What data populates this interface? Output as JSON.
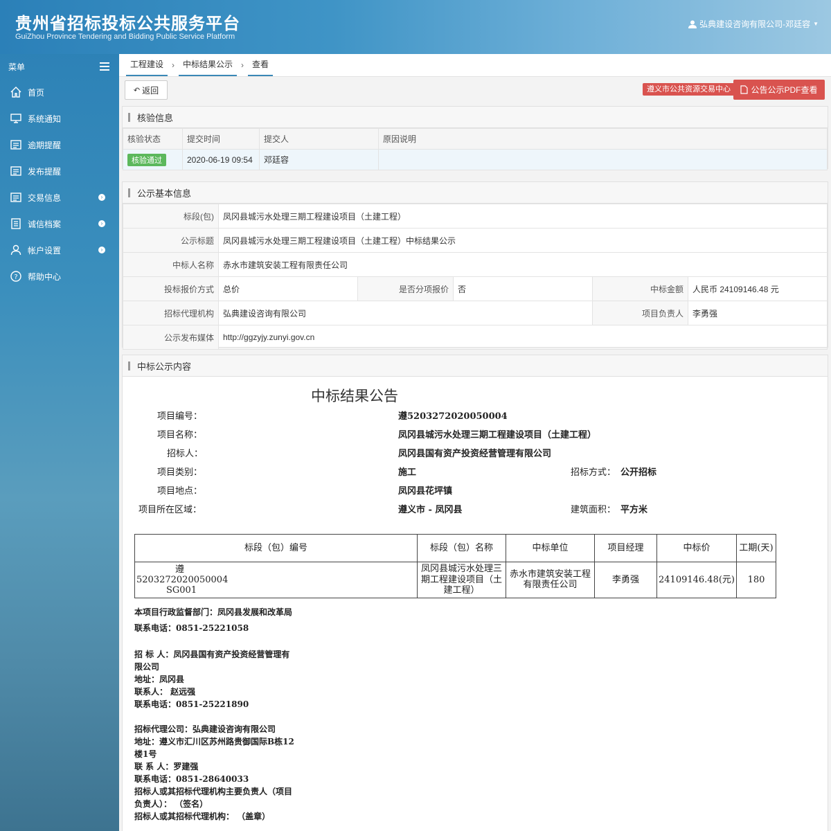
{
  "header": {
    "title": "贵州省招标投标公共服务平台",
    "subtitle": "GuiZhou Province Tendering and Bidding Public Service Platform",
    "user": "弘典建设咨询有限公司-邓廷容"
  },
  "sidebar": {
    "menu_label": "菜单",
    "items": [
      {
        "label": "首页",
        "icon": "home-icon",
        "arrow": false
      },
      {
        "label": "系统通知",
        "icon": "monitor-icon",
        "arrow": false
      },
      {
        "label": "逾期提醒",
        "icon": "list-icon",
        "arrow": false
      },
      {
        "label": "发布提醒",
        "icon": "list-icon",
        "arrow": false
      },
      {
        "label": "交易信息",
        "icon": "list-icon",
        "arrow": true
      },
      {
        "label": "诚信档案",
        "icon": "document-icon",
        "arrow": true
      },
      {
        "label": "帐户设置",
        "icon": "user-icon",
        "arrow": true
      },
      {
        "label": "帮助中心",
        "icon": "help-icon",
        "arrow": false
      }
    ]
  },
  "breadcrumb": [
    "工程建设",
    "中标结果公示",
    "查看"
  ],
  "toolbar": {
    "back": "返回",
    "center_tag": "遵义市公共资源交易中心",
    "pdf": "公告公示PDF查看"
  },
  "verify": {
    "title": "核验信息",
    "headers": [
      "核验状态",
      "提交时间",
      "提交人",
      "原因说明"
    ],
    "status": "核验通过",
    "time": "2020-06-19 09:54",
    "submitter": "邓廷容",
    "reason": ""
  },
  "basic": {
    "title": "公示基本信息",
    "section_label": "标段(包)",
    "section": "凤冈县城污水处理三期工程建设项目（土建工程）",
    "notice_title_label": "公示标题",
    "notice_title": "凤冈县城污水处理三期工程建设项目（土建工程）中标结果公示",
    "winner_label": "中标人名称",
    "winner": "赤水市建筑安装工程有限责任公司",
    "quote_label": "投标报价方式",
    "quote": "总价",
    "sub_quote_label": "是否分项报价",
    "sub_quote": "否",
    "amount_label": "中标金额",
    "amount": "人民币 24109146.48 元",
    "agency_label": "招标代理机构",
    "agency": "弘典建设咨询有限公司",
    "manager_label": "项目负责人",
    "manager": "李勇强",
    "media_label": "公示发布媒体",
    "media": "http://ggzyjy.zunyi.gov.cn"
  },
  "content": {
    "title": "中标公示内容",
    "doc_title": "中标结果公告",
    "fields": {
      "code_label": "项目编号：",
      "code": "遵5203272020050004",
      "name_label": "项目名称：",
      "name": "凤冈县城污水处理三期工程建设项目（土建工程）",
      "tenderer_label": "招标人：",
      "tenderer": "凤冈县国有资产投资经营管理有限公司",
      "type_label": "项目类别：",
      "type": "施工",
      "method_label": "招标方式：",
      "method": "公开招标",
      "place_label": "项目地点：",
      "place": "凤冈县花坪镇",
      "region_label": "项目所在区域：",
      "region": "遵义市 - 凤冈县",
      "area_label": "建筑面积：",
      "area": "平方米"
    },
    "table": {
      "headers": [
        "标段（包）编号",
        "标段（包）名称",
        "中标单位",
        "项目经理",
        "中标价",
        "工期(天)"
      ],
      "row": {
        "code_1": "遵",
        "code_2": "5203272020050004",
        "code_3": "SG001",
        "name": "凤冈县城污水处理三期工程建设项目（土建工程）",
        "unit": "赤水市建筑安装工程有限责任公司",
        "manager": "李勇强",
        "price": "24109146.48(元)",
        "days": "180"
      }
    },
    "footer": {
      "l1": "本项目行政监督部门：凤冈县发展和改革局",
      "l2": "联系电话：0851-25221058",
      "l3": "招 标 人：凤冈县国有资产投资经营管理有",
      "l4": "限公司",
      "l5": "地址：凤冈县",
      "l6": "联系人： 赵远强",
      "l7": "联系电话：0851-25221890",
      "l8": "招标代理公司：弘典建设咨询有限公司",
      "l9": "地址：遵义市汇川区苏州路贵御国际B栋12",
      "l10": "楼1号",
      "l11": "联 系 人：罗建强",
      "l12": "联系电话：0851-28640033",
      "l13": "招标人或其招标代理机构主要负责人（项目",
      "l14": "负责人）：  （签名）",
      "l15": "招标人或其招标代理机构：  （盖章）"
    }
  }
}
